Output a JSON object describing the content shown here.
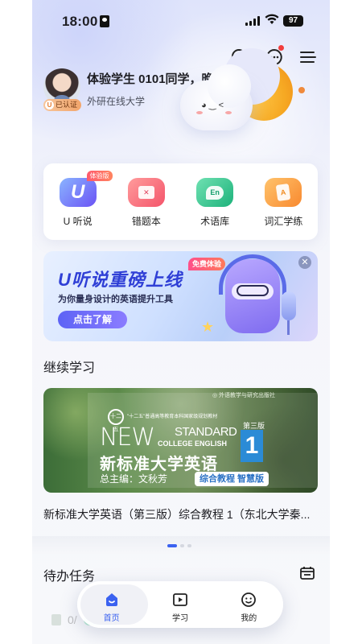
{
  "status_bar": {
    "time": "18:00",
    "battery": "97"
  },
  "profile": {
    "greeting": "体验学生 0101同学，晚上好",
    "school": "外研在线大学",
    "verified_label": "已认证",
    "verified_letter": "U"
  },
  "quick_actions": [
    {
      "label": "U 听说",
      "icon": "u-listen-icon",
      "badge": "体验版",
      "glyph": "U"
    },
    {
      "label": "错题本",
      "icon": "error-book-icon",
      "glyph": "✕"
    },
    {
      "label": "术语库",
      "icon": "term-bank-icon",
      "glyph": "En"
    },
    {
      "label": "词汇学练",
      "icon": "vocab-practice-icon",
      "glyph": "A"
    }
  ],
  "banner": {
    "title": "U听说重磅上线",
    "subtitle": "为你量身设计的英语提升工具",
    "button": "点击了解",
    "tag": "免费体验",
    "close": "✕"
  },
  "continue_section": {
    "title": "继续学习",
    "course": {
      "cover_brand_new": "NEW",
      "cover_brand_standard": "STANDARD",
      "cover_college": "COLLEGE ENGLISH",
      "cover_edition": "第三版",
      "cover_volume": "1",
      "cover_title": "新标准大学英语",
      "cover_editor": "总主编：文秋芳",
      "cover_tag": "综合教程 智慧版",
      "cover_seal": "十二五",
      "cover_plan": "\"十二五\"普通高等教育本科国家级规划教材",
      "name": "新标准大学英语（第三版）综合教程 1（东北大学秦..."
    }
  },
  "todo": {
    "title": "待办任务",
    "peek_text": "0/"
  },
  "bottom_nav": [
    {
      "label": "首页",
      "icon": "home-icon",
      "active": true
    },
    {
      "label": "学习",
      "icon": "learn-icon",
      "active": false
    },
    {
      "label": "我的",
      "icon": "profile-icon",
      "active": false
    }
  ],
  "colors": {
    "accent": "#3b62f0",
    "badge_red": "#f23d3d",
    "banner_title": "#2f3fd6"
  }
}
